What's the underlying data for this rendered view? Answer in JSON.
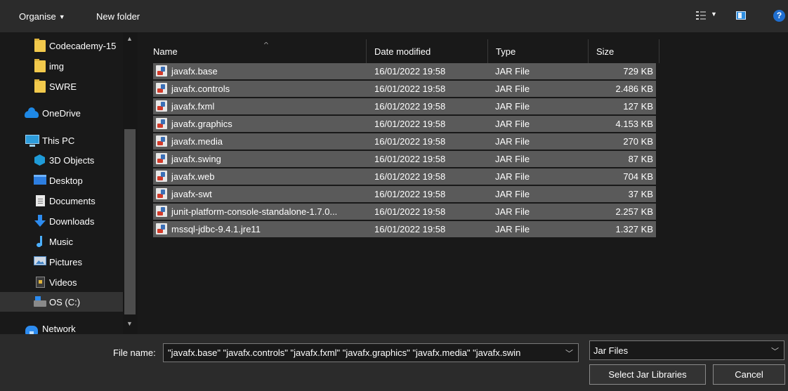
{
  "toolbar": {
    "organise_label": "Organise",
    "new_folder_label": "New folder",
    "help_glyph": "?",
    "icons": [
      "chevron-down-icon",
      "view-options-icon",
      "preview-pane-icon",
      "help-icon"
    ]
  },
  "nav": {
    "items": [
      {
        "label": "Codecademy-15",
        "icon": "folder-icon"
      },
      {
        "label": "img",
        "icon": "folder-icon"
      },
      {
        "label": "SWRE",
        "icon": "folder-icon"
      },
      {
        "label": "OneDrive",
        "icon": "onedrive-icon"
      },
      {
        "label": "This PC",
        "icon": "this-pc-icon"
      },
      {
        "label": "3D Objects",
        "icon": "3d-objects-icon"
      },
      {
        "label": "Desktop",
        "icon": "desktop-icon"
      },
      {
        "label": "Documents",
        "icon": "documents-icon"
      },
      {
        "label": "Downloads",
        "icon": "downloads-icon"
      },
      {
        "label": "Music",
        "icon": "music-icon"
      },
      {
        "label": "Pictures",
        "icon": "pictures-icon"
      },
      {
        "label": "Videos",
        "icon": "videos-icon"
      },
      {
        "label": "OS (C:)",
        "icon": "drive-icon"
      },
      {
        "label": "Network",
        "icon": "network-icon"
      }
    ],
    "selected": "OS (C:)"
  },
  "file_list": {
    "columns": [
      "Name",
      "Date modified",
      "Type",
      "Size"
    ],
    "rows": [
      {
        "name": "javafx.base",
        "date": "16/01/2022 19:58",
        "type": "JAR File",
        "size": "729 KB"
      },
      {
        "name": "javafx.controls",
        "date": "16/01/2022 19:58",
        "type": "JAR File",
        "size": "2.486 KB"
      },
      {
        "name": "javafx.fxml",
        "date": "16/01/2022 19:58",
        "type": "JAR File",
        "size": "127 KB"
      },
      {
        "name": "javafx.graphics",
        "date": "16/01/2022 19:58",
        "type": "JAR File",
        "size": "4.153 KB"
      },
      {
        "name": "javafx.media",
        "date": "16/01/2022 19:58",
        "type": "JAR File",
        "size": "270 KB"
      },
      {
        "name": "javafx.swing",
        "date": "16/01/2022 19:58",
        "type": "JAR File",
        "size": "87 KB"
      },
      {
        "name": "javafx.web",
        "date": "16/01/2022 19:58",
        "type": "JAR File",
        "size": "704 KB"
      },
      {
        "name": "javafx-swt",
        "date": "16/01/2022 19:58",
        "type": "JAR File",
        "size": "37 KB"
      },
      {
        "name": "junit-platform-console-standalone-1.7.0...",
        "date": "16/01/2022 19:58",
        "type": "JAR File",
        "size": "2.257 KB"
      },
      {
        "name": "mssql-jdbc-9.4.1.jre11",
        "date": "16/01/2022 19:58",
        "type": "JAR File",
        "size": "1.327 KB"
      }
    ]
  },
  "bottom": {
    "file_name_label": "File name:",
    "file_name_value": "\"javafx.base\" \"javafx.controls\" \"javafx.fxml\" \"javafx.graphics\" \"javafx.media\" \"javafx.swin",
    "filter_value": "Jar Files",
    "select_button": "Select Jar Libraries",
    "cancel_button": "Cancel"
  },
  "colors": {
    "background": "#191919",
    "toolbar": "#2b2b2b",
    "selected_row": "#5a5a5a",
    "accent": "#1f6fd1"
  }
}
